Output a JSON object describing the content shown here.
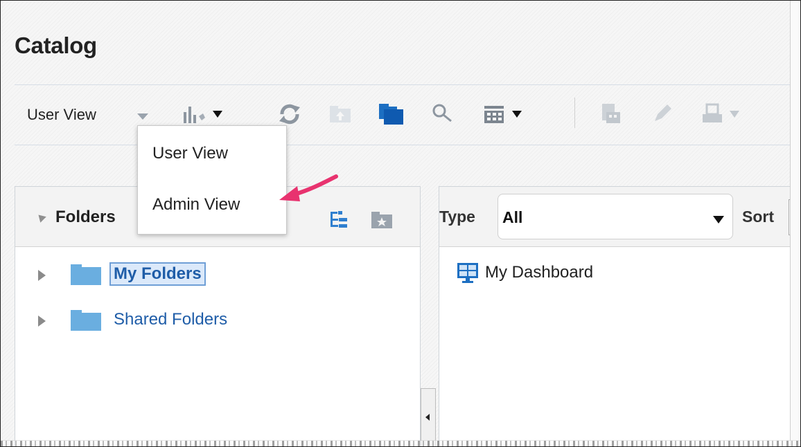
{
  "page": {
    "title": "Catalog"
  },
  "toolbar": {
    "view_selector": {
      "label": "User View"
    },
    "icons": [
      "bar-chart-new-icon",
      "refresh-icon",
      "upload-icon",
      "folder-stack-icon",
      "search-icon",
      "grid-view-icon",
      "archive-icon",
      "edit-icon",
      "print-icon"
    ]
  },
  "view_menu": {
    "items": [
      {
        "label": "User View"
      },
      {
        "label": "Admin View"
      }
    ]
  },
  "folders_panel": {
    "title": "Folders",
    "items": [
      {
        "label": "My Folders",
        "selected": true
      },
      {
        "label": "Shared Folders",
        "selected": false
      }
    ]
  },
  "content_panel": {
    "type_label": "Type",
    "type_value": "All",
    "sort_label": "Sort",
    "items": [
      {
        "label": "My Dashboard",
        "icon": "dashboard-icon"
      }
    ]
  },
  "colors": {
    "accent_blue": "#1d6fc2",
    "folder_blue": "#6aaee0",
    "link_blue": "#1f5da8",
    "annotation_pink": "#e8336f"
  }
}
